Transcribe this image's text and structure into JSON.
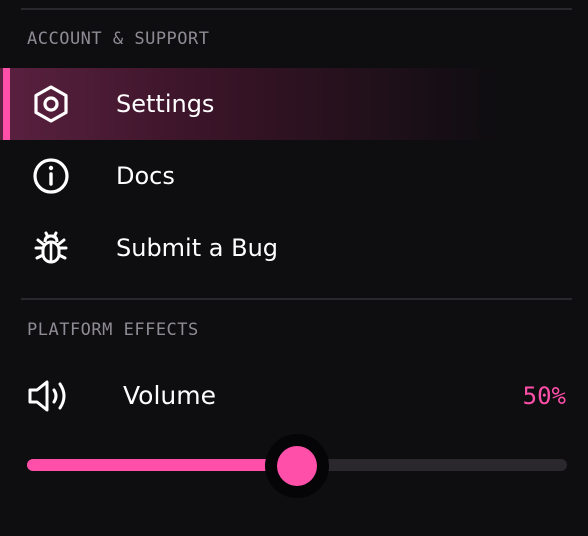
{
  "account_section": {
    "title": "ACCOUNT & SUPPORT",
    "items": [
      {
        "label": "Settings",
        "icon": "settings-hexagon-icon",
        "active": true
      },
      {
        "label": "Docs",
        "icon": "info-icon",
        "active": false
      },
      {
        "label": "Submit a Bug",
        "icon": "bug-icon",
        "active": false
      }
    ]
  },
  "platform_section": {
    "title": "PLATFORM EFFECTS",
    "volume": {
      "label": "Volume",
      "value_text": "50%",
      "level": 0.5,
      "icon": "speaker-volume-icon"
    }
  },
  "colors": {
    "accent": "#ff4fa8",
    "background": "#0e0d10",
    "muted_text": "#8f8b94",
    "track": "#2a282d"
  }
}
